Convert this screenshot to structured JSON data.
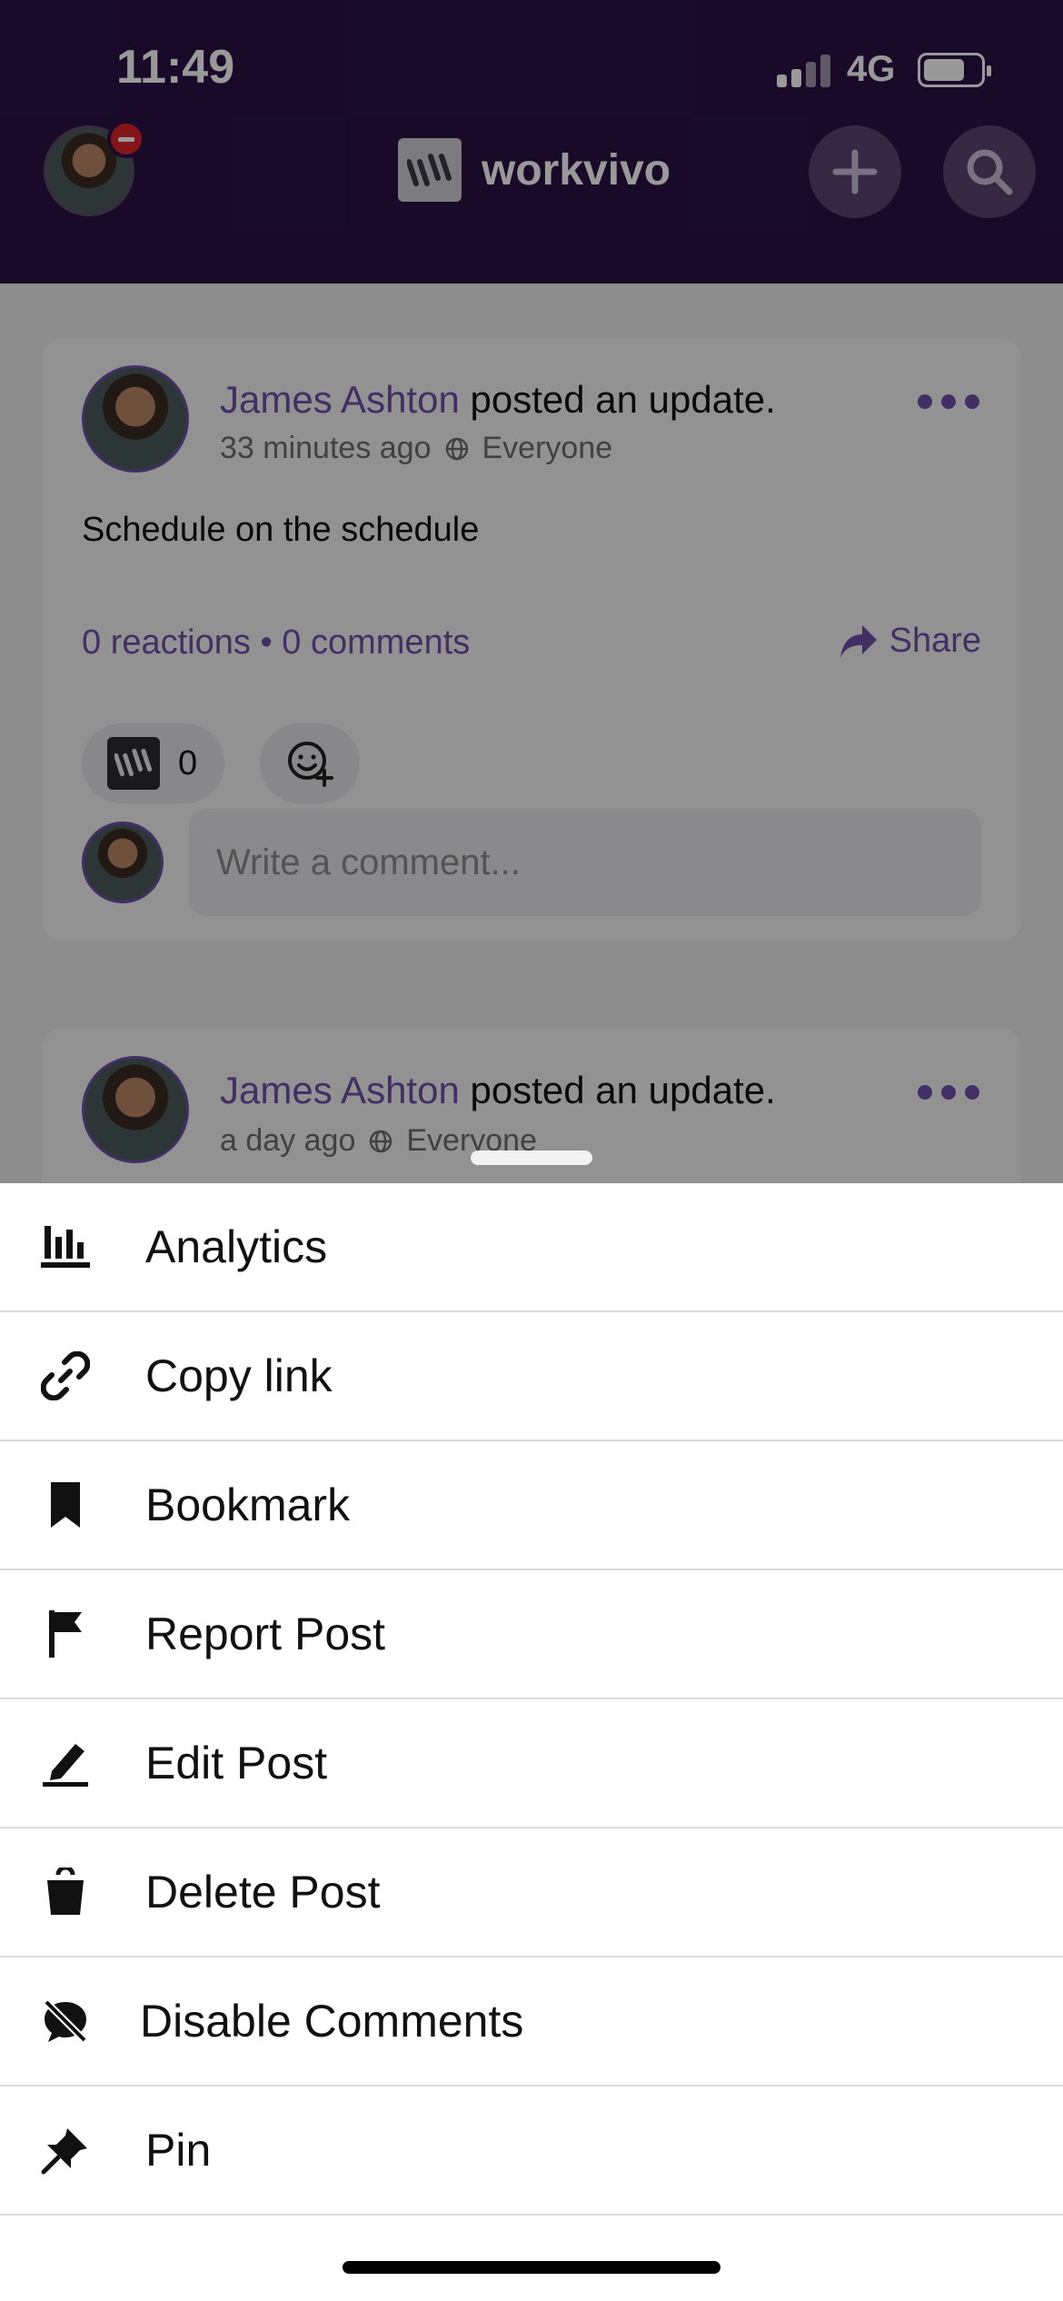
{
  "status_bar": {
    "time": "11:49",
    "network": "4G"
  },
  "header": {
    "brand": "workvivo"
  },
  "posts": [
    {
      "author": "James Ashton",
      "action": " posted an update.",
      "time": "33 minutes ago",
      "audience": "Everyone",
      "text": "Schedule on the schedule",
      "stats": "0 reactions • 0 comments",
      "share": "Share",
      "reaction_count": "0",
      "comment_placeholder": "Write a comment..."
    },
    {
      "author": "James Ashton",
      "action": " posted an update.",
      "time": "a day ago",
      "audience": "Everyone"
    }
  ],
  "menu": {
    "items": [
      {
        "label": "Analytics",
        "icon": "bar-chart-icon"
      },
      {
        "label": "Copy link",
        "icon": "link-icon"
      },
      {
        "label": "Bookmark",
        "icon": "bookmark-icon"
      },
      {
        "label": "Report Post",
        "icon": "flag-icon"
      },
      {
        "label": "Edit Post",
        "icon": "pencil-icon"
      },
      {
        "label": "Delete Post",
        "icon": "trash-icon"
      },
      {
        "label": "Disable Comments",
        "icon": "comment-off-icon"
      },
      {
        "label": "Pin",
        "icon": "pin-icon"
      }
    ]
  },
  "colors": {
    "header": "#2a1246",
    "accent": "#6d4fa8",
    "notification": "#e0242c"
  }
}
